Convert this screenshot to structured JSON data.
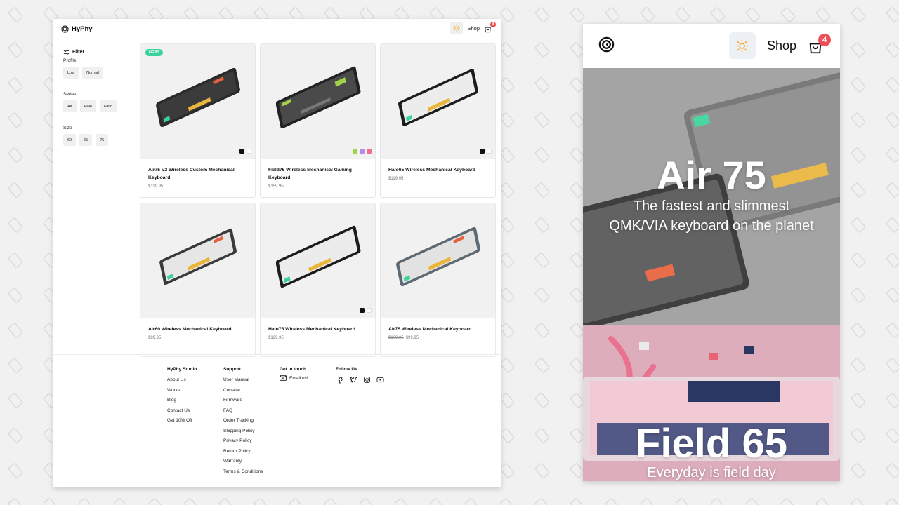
{
  "brand": {
    "name": "HyPhy"
  },
  "nav": {
    "shop_label": "Shop",
    "cart_count": "4",
    "theme_icon": "sun-icon",
    "cart_icon": "shopping-bag-icon"
  },
  "filters": {
    "title": "Filter",
    "groups": [
      {
        "label": "Profile",
        "options": [
          "Low",
          "Normal"
        ]
      },
      {
        "label": "Series",
        "options": [
          "Air",
          "Halo",
          "Field"
        ]
      },
      {
        "label": "Size",
        "options": [
          "60",
          "65",
          "75"
        ]
      }
    ]
  },
  "products": [
    {
      "name": "Air75 V2 Wireless Custom Mechanical Keyboard",
      "price": "$119.95",
      "old_price": "",
      "badge": "NEW!",
      "swatches": [
        "#111111",
        "#ffffff"
      ]
    },
    {
      "name": "Field75 Wireless Mechanical Gaming Keyboard",
      "price": "$159.95",
      "old_price": "",
      "badge": "",
      "swatches": [
        "#a3d14b",
        "#b58ce8",
        "#ef6f8d"
      ]
    },
    {
      "name": "Halo65 Wireless Mechanical Keyboard",
      "price": "$119.95",
      "old_price": "",
      "badge": "",
      "swatches": [
        "#111111",
        "#ffffff"
      ]
    },
    {
      "name": "Air60 Wireless Mechanical Keyboard",
      "price": "$99.95",
      "old_price": "",
      "badge": "",
      "swatches": []
    },
    {
      "name": "Halo75 Wireless Mechanical Keyboard",
      "price": "$129.95",
      "old_price": "",
      "badge": "",
      "swatches": [
        "#111111",
        "#ffffff"
      ]
    },
    {
      "name": "Air75 Wireless Mechanical Keyboard",
      "price": "$99.95",
      "old_price": "$109.95",
      "badge": "",
      "swatches": []
    }
  ],
  "footer": {
    "columns": [
      {
        "heading": "HyPhy Studio",
        "links": [
          "About Us",
          "Works",
          "Blog",
          "Contact Us",
          "Get 10% Off"
        ]
      },
      {
        "heading": "Support",
        "links": [
          "User Manual",
          "Console",
          "Firmware",
          "FAQ",
          "Order Tracking",
          "Shipping Policy",
          "Privacy Policy",
          "Return Policy",
          "Warranty",
          "Terms & Conditions"
        ]
      },
      {
        "heading": "Get in touch",
        "email_label": "Email us!"
      },
      {
        "heading": "Follow Us",
        "icons": [
          "facebook-icon",
          "twitter-icon",
          "instagram-icon",
          "youtube-icon"
        ]
      }
    ]
  },
  "mobile": {
    "shop_label": "Shop",
    "cart_count": "4",
    "hero1": {
      "title": "Air 75",
      "subtitle_line1": "The fastest and slimmest",
      "subtitle_line2": "QMK/VIA keyboard on the planet"
    },
    "hero2": {
      "title": "Field 65",
      "subtitle": "Everyday is field day"
    }
  },
  "colors": {
    "accent": "#3ad39a",
    "badge": "#ef4e56",
    "background": "#f1f1f1",
    "sun": "#f5a623"
  }
}
